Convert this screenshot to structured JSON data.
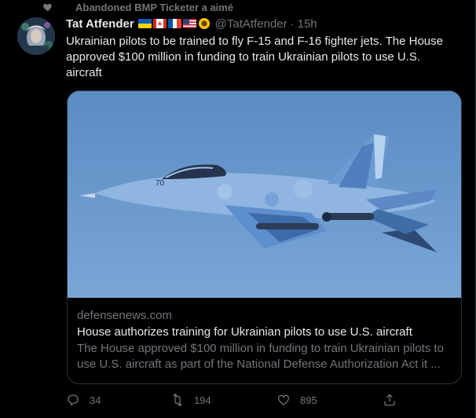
{
  "social_context": {
    "text": "Abandoned BMP Ticketer a aimé",
    "icon": "heart-icon"
  },
  "tweet": {
    "display_name": "Tat Atfender",
    "flags": [
      "ukraine-flag",
      "canada-flag",
      "france-flag",
      "usa-flag",
      "sunflower"
    ],
    "handle": "@TatAtfender",
    "separator": "·",
    "time": "15h",
    "text": "Ukrainian pilots to be trained to fly F-15 and F-16 fighter jets. The House approved $100 million in funding to train Ukrainian pilots to use U.S. aircraft"
  },
  "card": {
    "image": "fighter-jet-photo",
    "domain": "defensenews.com",
    "title": "House authorizes training for Ukrainian pilots to use U.S. aircraft",
    "description": "The House approved $100 million in funding to train Ukrainian pilots to use U.S. aircraft as part of the National Defense Authorization Act it ..."
  },
  "actions": {
    "reply": {
      "icon": "reply-icon",
      "count": "34"
    },
    "retweet": {
      "icon": "retweet-icon",
      "count": "194"
    },
    "like": {
      "icon": "like-icon",
      "count": "895"
    },
    "share": {
      "icon": "share-icon"
    }
  },
  "colors": {
    "background": "#000000",
    "text": "#e7e9ea",
    "secondary": "#71767b",
    "border": "#2f3336",
    "sky": "#5f90c7"
  }
}
